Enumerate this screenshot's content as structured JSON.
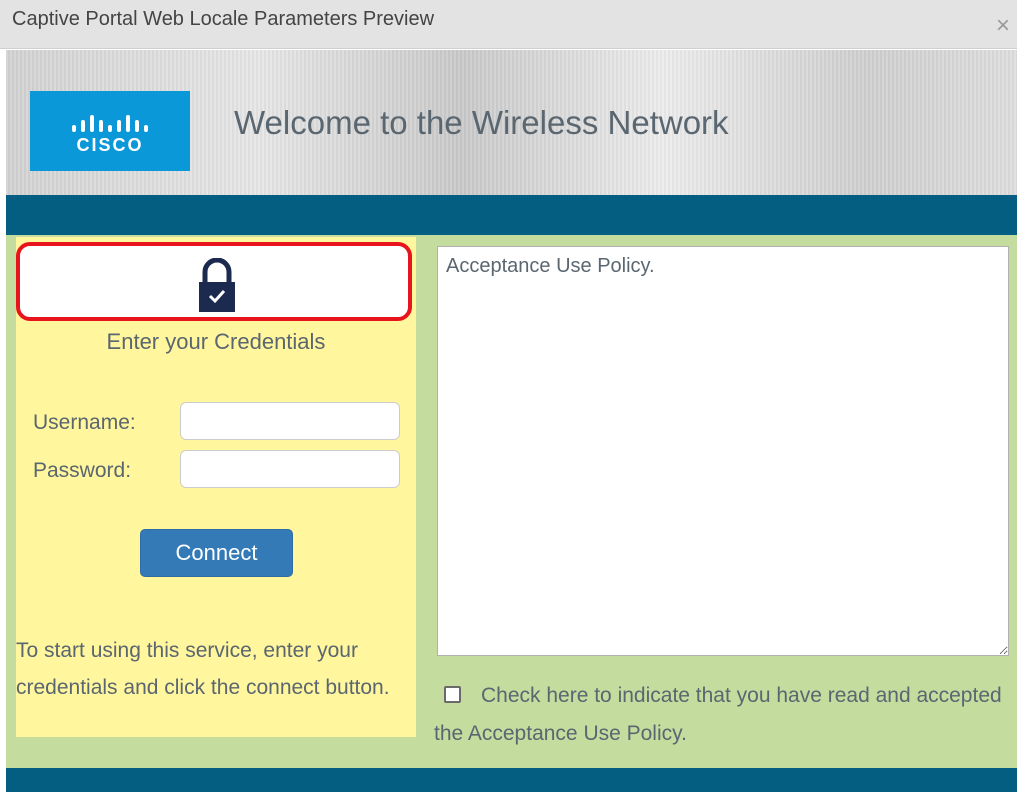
{
  "window": {
    "title": "Captive Portal Web Locale Parameters Preview",
    "close_glyph": "×"
  },
  "banner": {
    "logo_word": "CISCO",
    "welcome_text": "Welcome to the Wireless Network"
  },
  "login": {
    "lock_icon": "lock-icon",
    "credentials_title": "Enter your Credentials",
    "username_label": "Username:",
    "username_value": "",
    "password_label": "Password:",
    "password_value": "",
    "connect_label": "Connect",
    "help_text": "To start using this service, enter your credentials and click the connect button."
  },
  "policy": {
    "text": "Acceptance Use Policy.",
    "accept_label": "Check here to indicate that you have read and accepted the Acceptance Use Policy.",
    "accepted": false
  },
  "colors": {
    "logo_blue": "#0a98d8",
    "strip_teal": "#035e81",
    "panel_yellow": "#fff69d",
    "background_green": "#c4dd9f",
    "button_blue": "#337ab7",
    "highlight_red": "#e8141b"
  }
}
